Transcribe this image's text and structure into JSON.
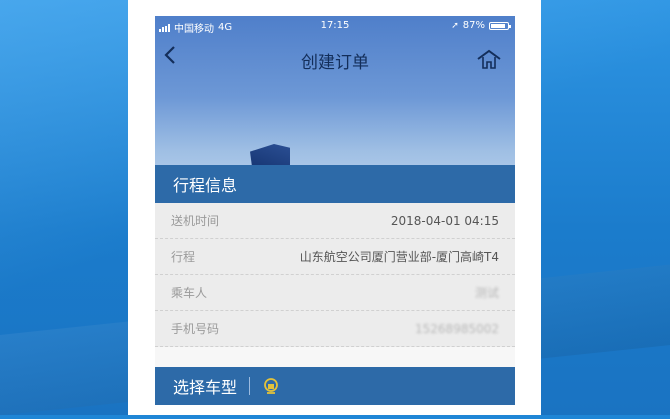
{
  "status_bar": {
    "carrier": "中国移动",
    "network": "4G",
    "time": "17:15",
    "battery": "87%"
  },
  "nav": {
    "back_icon": "chevron-left-icon",
    "title": "创建订单",
    "home_icon": "home-icon"
  },
  "trip_section": {
    "title": "行程信息",
    "rows": [
      {
        "label": "送机时间",
        "value": "2018-04-01 04:15"
      },
      {
        "label": "行程",
        "value": "山东航空公司厦门营业部-厦门高崎T4"
      },
      {
        "label": "乘车人",
        "value": "测试"
      },
      {
        "label": "手机号码",
        "value": "15268985002"
      }
    ]
  },
  "vehicle_section": {
    "title": "选择车型",
    "icon": "badge-icon"
  },
  "colors": {
    "section_bar": "#2d6aa8",
    "background": "#1f86d6",
    "nav_text": "#132e5a"
  }
}
